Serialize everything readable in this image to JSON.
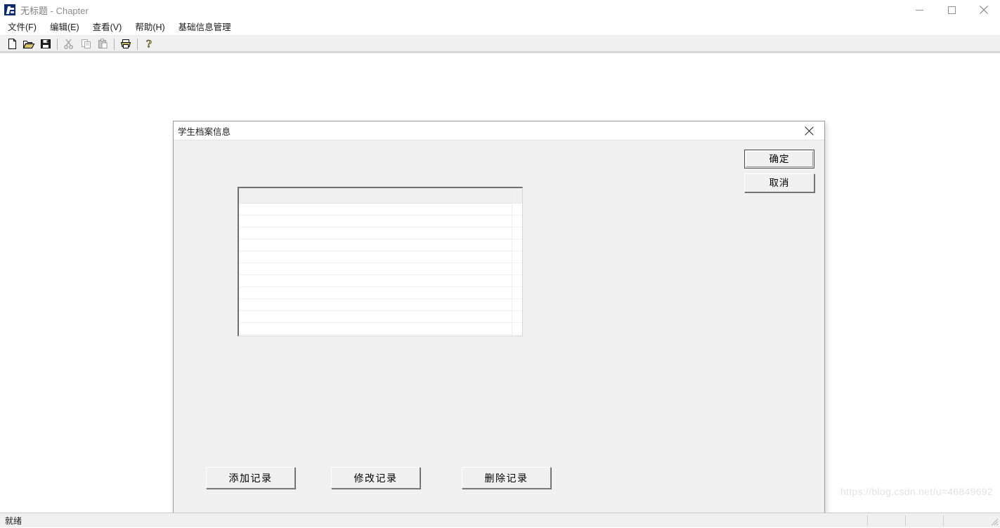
{
  "window": {
    "icon_name": "mfc-app-icon",
    "document_name": "无标题",
    "app_name": "Chapter",
    "title_separator": " - ",
    "controls": {
      "minimize_label": "最小化",
      "maximize_label": "最大化",
      "close_label": "关闭"
    }
  },
  "menu": {
    "items": [
      {
        "label": "文件(F)"
      },
      {
        "label": "编辑(E)"
      },
      {
        "label": "查看(V)"
      },
      {
        "label": "帮助(H)"
      },
      {
        "label": "基础信息管理"
      }
    ]
  },
  "toolbar": {
    "buttons": [
      {
        "icon": "new-document-icon",
        "label": "新建"
      },
      {
        "icon": "open-folder-icon",
        "label": "打开"
      },
      {
        "icon": "save-disk-icon",
        "label": "保存"
      },
      {
        "icon": "cut-scissors-icon",
        "label": "剪切"
      },
      {
        "icon": "copy-icon",
        "label": "复制"
      },
      {
        "icon": "paste-clipboard-icon",
        "label": "粘贴"
      },
      {
        "icon": "print-icon",
        "label": "打印"
      },
      {
        "icon": "help-question-icon",
        "label": "帮助"
      }
    ]
  },
  "dialog": {
    "title": "学生档案信息",
    "close_icon": "close-icon",
    "ok_button": "确定",
    "cancel_button": "取消",
    "action_buttons": [
      {
        "label": "添加记录",
        "name": "add-record-button"
      },
      {
        "label": "修改记录",
        "name": "modify-record-button"
      },
      {
        "label": "删除记录",
        "name": "delete-record-button"
      }
    ],
    "record_list": {
      "columns": [],
      "rows": [],
      "empty_row_count": 11
    }
  },
  "status_bar": {
    "text": "就绪"
  },
  "watermark": {
    "text": "https://blog.csdn.net/u=46849692"
  },
  "colors": {
    "window_background": "#ffffff",
    "dialog_face": "#f0f0f0",
    "toolbar_face": "#f0f0f0",
    "status_face": "#f0f0f0",
    "title_text": "#8d8d8d",
    "border_dark": "#808080",
    "border_light": "#ffffff",
    "list_background": "#ffffff",
    "list_header": "#f0f0f0",
    "watermark": "#e2e2e2"
  }
}
